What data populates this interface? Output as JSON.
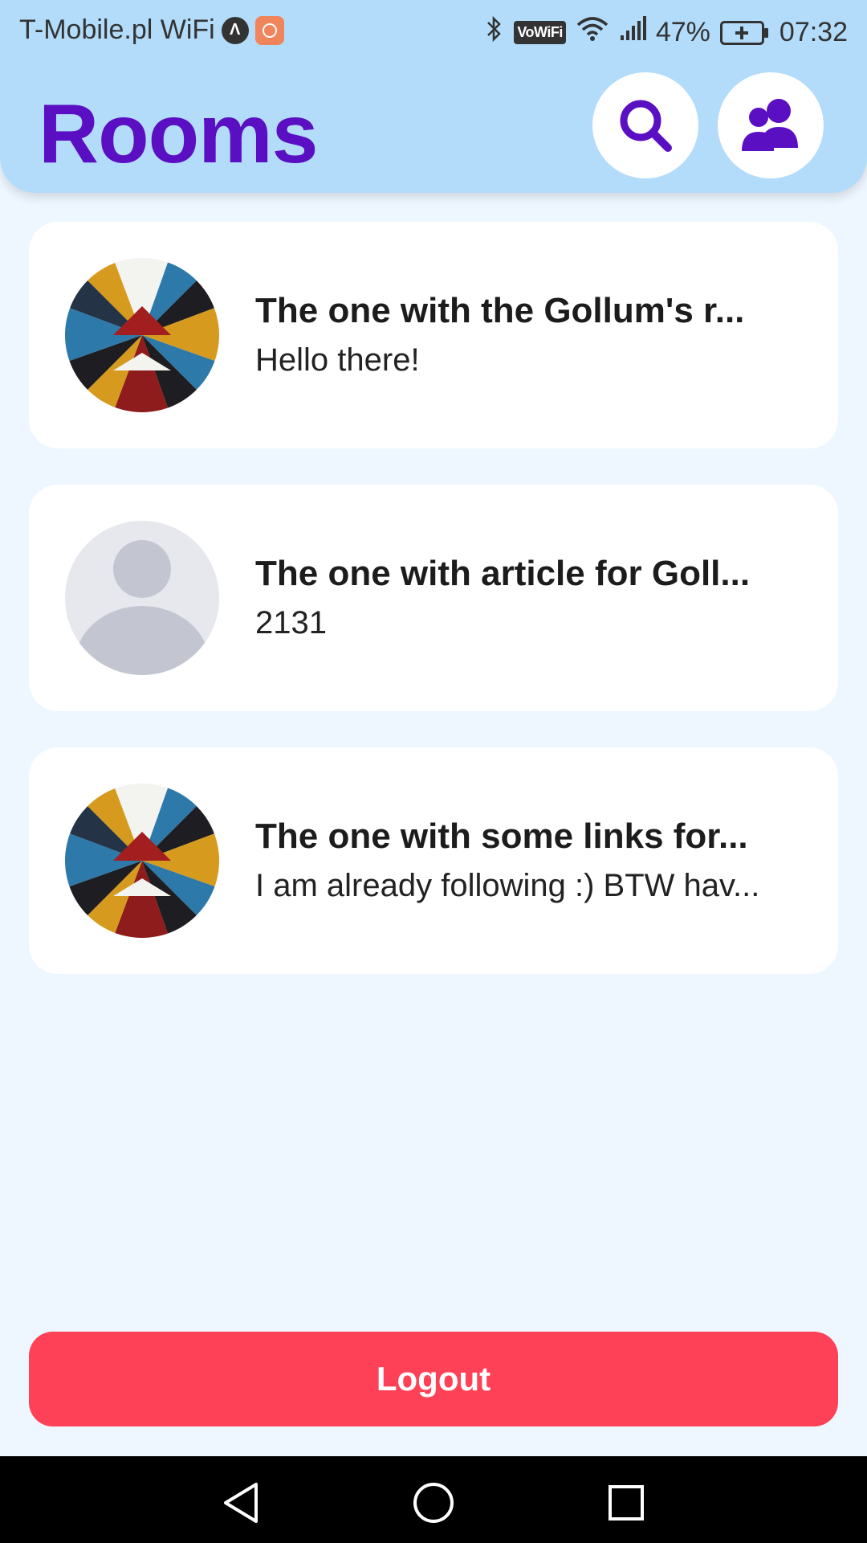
{
  "status_bar": {
    "carrier": "T-Mobile.pl WiFi",
    "vowifi": "VoWiFi",
    "battery": "47%",
    "time": "07:32"
  },
  "header": {
    "title": "Rooms",
    "search_icon": "search-icon",
    "users_icon": "users-icon"
  },
  "rooms": [
    {
      "name": "The one with the Gollum's r...",
      "preview": "Hello there!",
      "avatar": "geometric-art"
    },
    {
      "name": "The one with article for Goll...",
      "preview": "2131",
      "avatar": "default-person"
    },
    {
      "name": "The one with some links for...",
      "preview": "I am already following :) BTW hav...",
      "avatar": "geometric-art"
    }
  ],
  "logout": {
    "label": "Logout"
  },
  "colors": {
    "accent": "#5a0fc2",
    "header_bg": "#b3dcfb",
    "page_bg": "#eef6ff",
    "logout_bg": "#ff4157"
  }
}
